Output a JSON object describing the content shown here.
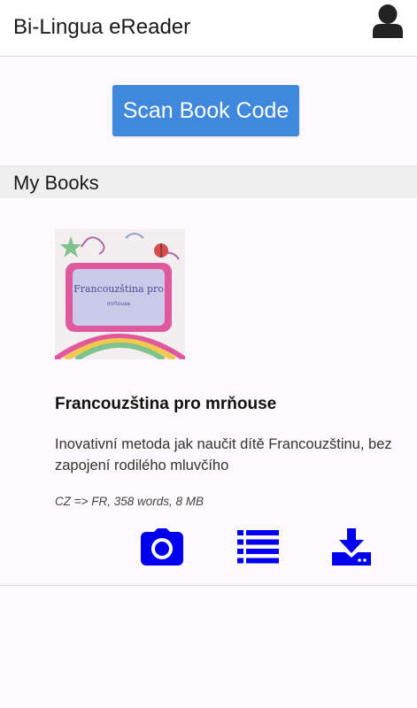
{
  "header": {
    "title": "Bi-Lingua eReader",
    "user_icon": "user-icon"
  },
  "scan": {
    "label": "Scan Book Code"
  },
  "section": {
    "title": "My Books"
  },
  "books": [
    {
      "cover_title": "Francouzština pro",
      "cover_subtitle": "mrňouse",
      "title": "Francouzština pro mrňouse",
      "description": "Inovativní metoda jak naučit dítě Francouzštinu, bez zapojení rodilého mluvčího",
      "meta": "CZ => FR, 358 words, 8 MB",
      "actions": [
        "camera-icon",
        "list-icon",
        "download-icon"
      ]
    }
  ],
  "colors": {
    "accent": "#3f88dd",
    "action_icon": "#0000ee",
    "background": "#fdf9fc",
    "section_bg": "#efefef"
  }
}
